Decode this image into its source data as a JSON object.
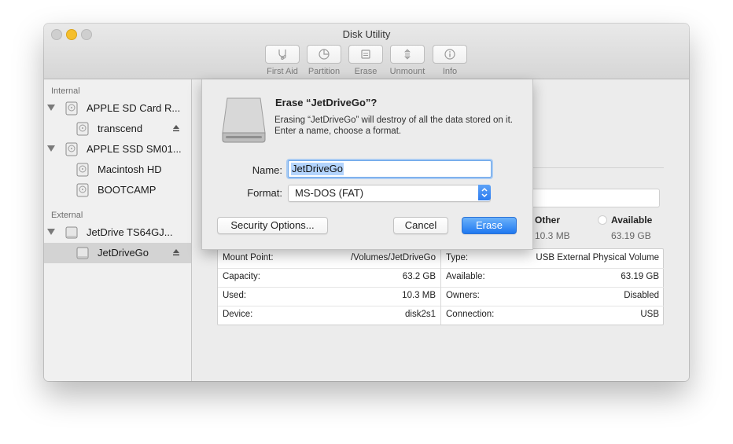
{
  "window": {
    "title": "Disk Utility"
  },
  "toolbar": {
    "items": [
      {
        "label": "First Aid",
        "icon": "stethoscope-icon"
      },
      {
        "label": "Partition",
        "icon": "pie-chart-icon"
      },
      {
        "label": "Erase",
        "icon": "erase-icon"
      },
      {
        "label": "Unmount",
        "icon": "unmount-icon"
      },
      {
        "label": "Info",
        "icon": "info-icon"
      }
    ]
  },
  "sidebar": {
    "internal_heading": "Internal",
    "external_heading": "External",
    "items": [
      {
        "label": "APPLE SD Card R..."
      },
      {
        "label": "transcend"
      },
      {
        "label": "APPLE SSD SM01..."
      },
      {
        "label": "Macintosh HD"
      },
      {
        "label": "BOOTCAMP"
      },
      {
        "label": "JetDrive TS64GJ..."
      },
      {
        "label": "JetDriveGo"
      }
    ]
  },
  "usage": {
    "other_label": "Other",
    "other_value": "10.3 MB",
    "available_label": "Available",
    "available_value": "63.19 GB"
  },
  "info": {
    "left": [
      {
        "key": "Mount Point:",
        "value": "/Volumes/JetDriveGo"
      },
      {
        "key": "Capacity:",
        "value": "63.2 GB"
      },
      {
        "key": "Used:",
        "value": "10.3 MB"
      },
      {
        "key": "Device:",
        "value": "disk2s1"
      }
    ],
    "right": [
      {
        "key": "Type:",
        "value": "USB External Physical Volume"
      },
      {
        "key": "Available:",
        "value": "63.19 GB"
      },
      {
        "key": "Owners:",
        "value": "Disabled"
      },
      {
        "key": "Connection:",
        "value": "USB"
      }
    ]
  },
  "dialog": {
    "title": "Erase “JetDriveGo”?",
    "message": "Erasing “JetDriveGo” will destroy of all the data stored on it. Enter a name, choose a format.",
    "name_label": "Name:",
    "name_value": "JetDriveGo",
    "format_label": "Format:",
    "format_value": "MS-DOS (FAT)",
    "security_button": "Security Options...",
    "cancel_button": "Cancel",
    "erase_button": "Erase"
  },
  "colors": {
    "accent": "#2c7cf0",
    "selection": "#b3d4fd",
    "minimize": "#f5bf2c"
  }
}
